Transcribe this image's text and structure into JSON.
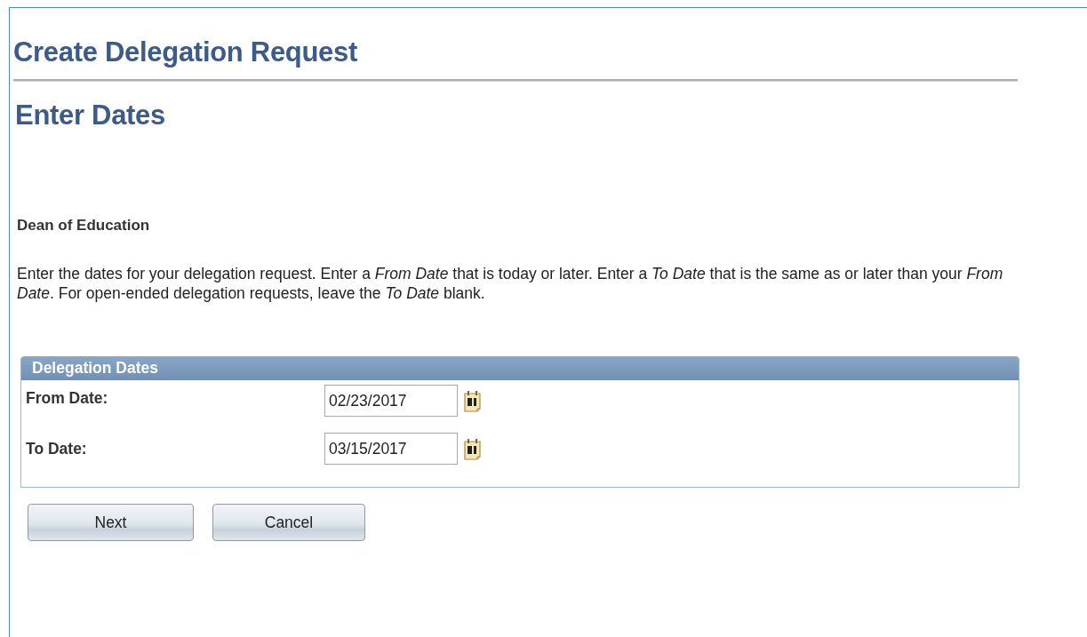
{
  "title": "Create Delegation Request",
  "subtitle": "Enter Dates",
  "role": "Dean of Education",
  "instructions": "Enter the dates for your delegation request. Enter a *From Date* that is today or later. Enter a *To Date* that is the same as or later than your *From Date*. For open-ended delegation requests, leave the *To Date* blank.",
  "panel": {
    "title": "Delegation Dates",
    "fields": [
      {
        "label": "From Date:",
        "value": "02/23/2017"
      },
      {
        "label": "To Date:",
        "value": "03/15/2017"
      }
    ]
  },
  "buttons": [
    "Next",
    "Cancel"
  ]
}
